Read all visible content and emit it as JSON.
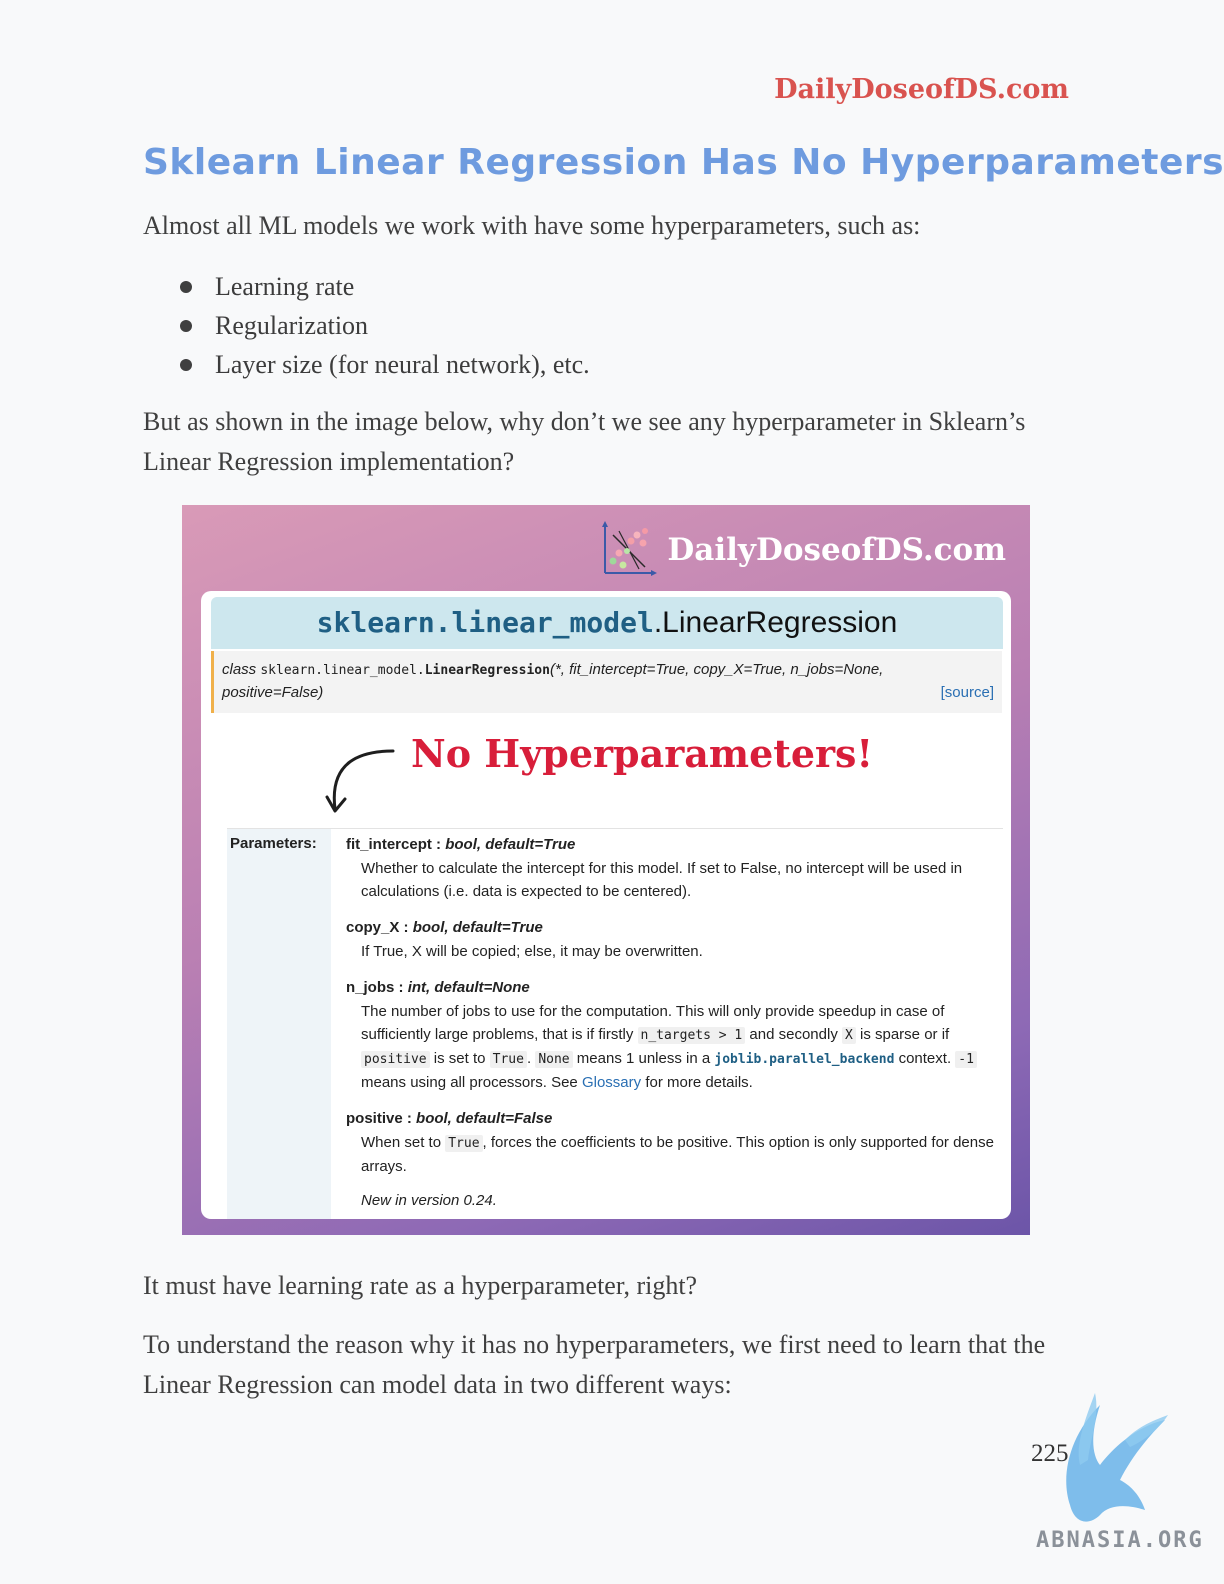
{
  "header": {
    "brand": "DailyDoseofDS.com"
  },
  "title": "Sklearn Linear Regression Has No Hyperparameters",
  "intro": "Almost all ML models we work with have some hyperparameters, such as:",
  "bullets": [
    "Learning rate",
    "Regularization",
    "Layer size (for neural network), etc."
  ],
  "question": "But as shown in the image below, why don’t we see any hyperparameter in Sklearn’s Linear Regression implementation?",
  "figure": {
    "logo_text": "DailyDoseofDS.com",
    "module": "sklearn.linear_model",
    "class_name": ".LinearRegression",
    "signature": {
      "keyword": "class",
      "qualified_module": "sklearn.linear_model.",
      "qualified_class": "LinearRegression",
      "args_line1": "(*, fit_intercept=True, copy_X=True, n_jobs=None,",
      "args_line2": "positive=False)",
      "source_link": "[source]"
    },
    "callout": "No Hyperparameters!",
    "params_heading": "Parameters:",
    "params": {
      "fit_intercept": {
        "name": "fit_intercept",
        "type": "bool, default=True",
        "desc": "Whether to calculate the intercept for this model. If set to False, no intercept will be used in calculations (i.e. data is expected to be centered)."
      },
      "copy_X": {
        "name": "copy_X",
        "type": "bool, default=True",
        "desc": "If True, X will be copied; else, it may be overwritten."
      },
      "n_jobs": {
        "name": "n_jobs",
        "type": "int, default=None",
        "desc_1": "The number of jobs to use for the computation. This will only provide speedup in case of sufficiently large problems, that is if firstly",
        "code_1": "n_targets > 1",
        "desc_2": "and secondly",
        "code_2": "X",
        "desc_3": "is sparse or if",
        "code_3": "positive",
        "desc_4": "is set to",
        "code_4": "True",
        "desc_5": ".",
        "code_5": "None",
        "desc_6": "means 1 unless in a",
        "link_code": "joblib.parallel_backend",
        "desc_7": "context.",
        "code_6": "-1",
        "desc_8": "means using all processors. See",
        "link": "Glossary",
        "desc_9": "for more details."
      },
      "positive": {
        "name": "positive",
        "type": "bool, default=False",
        "desc_1": "When set to",
        "code_1": "True",
        "desc_2": ", forces the coefficients to be positive. This option is only supported for dense arrays.",
        "version_note": "New in version 0.24."
      }
    }
  },
  "followup": "It must have learning rate as a hyperparameter, right?",
  "conclusion": "To understand the reason why it has no hyperparameters, we first need to learn that the Linear Regression can model data in two different ways:",
  "page_number": "225",
  "watermark": "ABNASIA.ORG"
}
